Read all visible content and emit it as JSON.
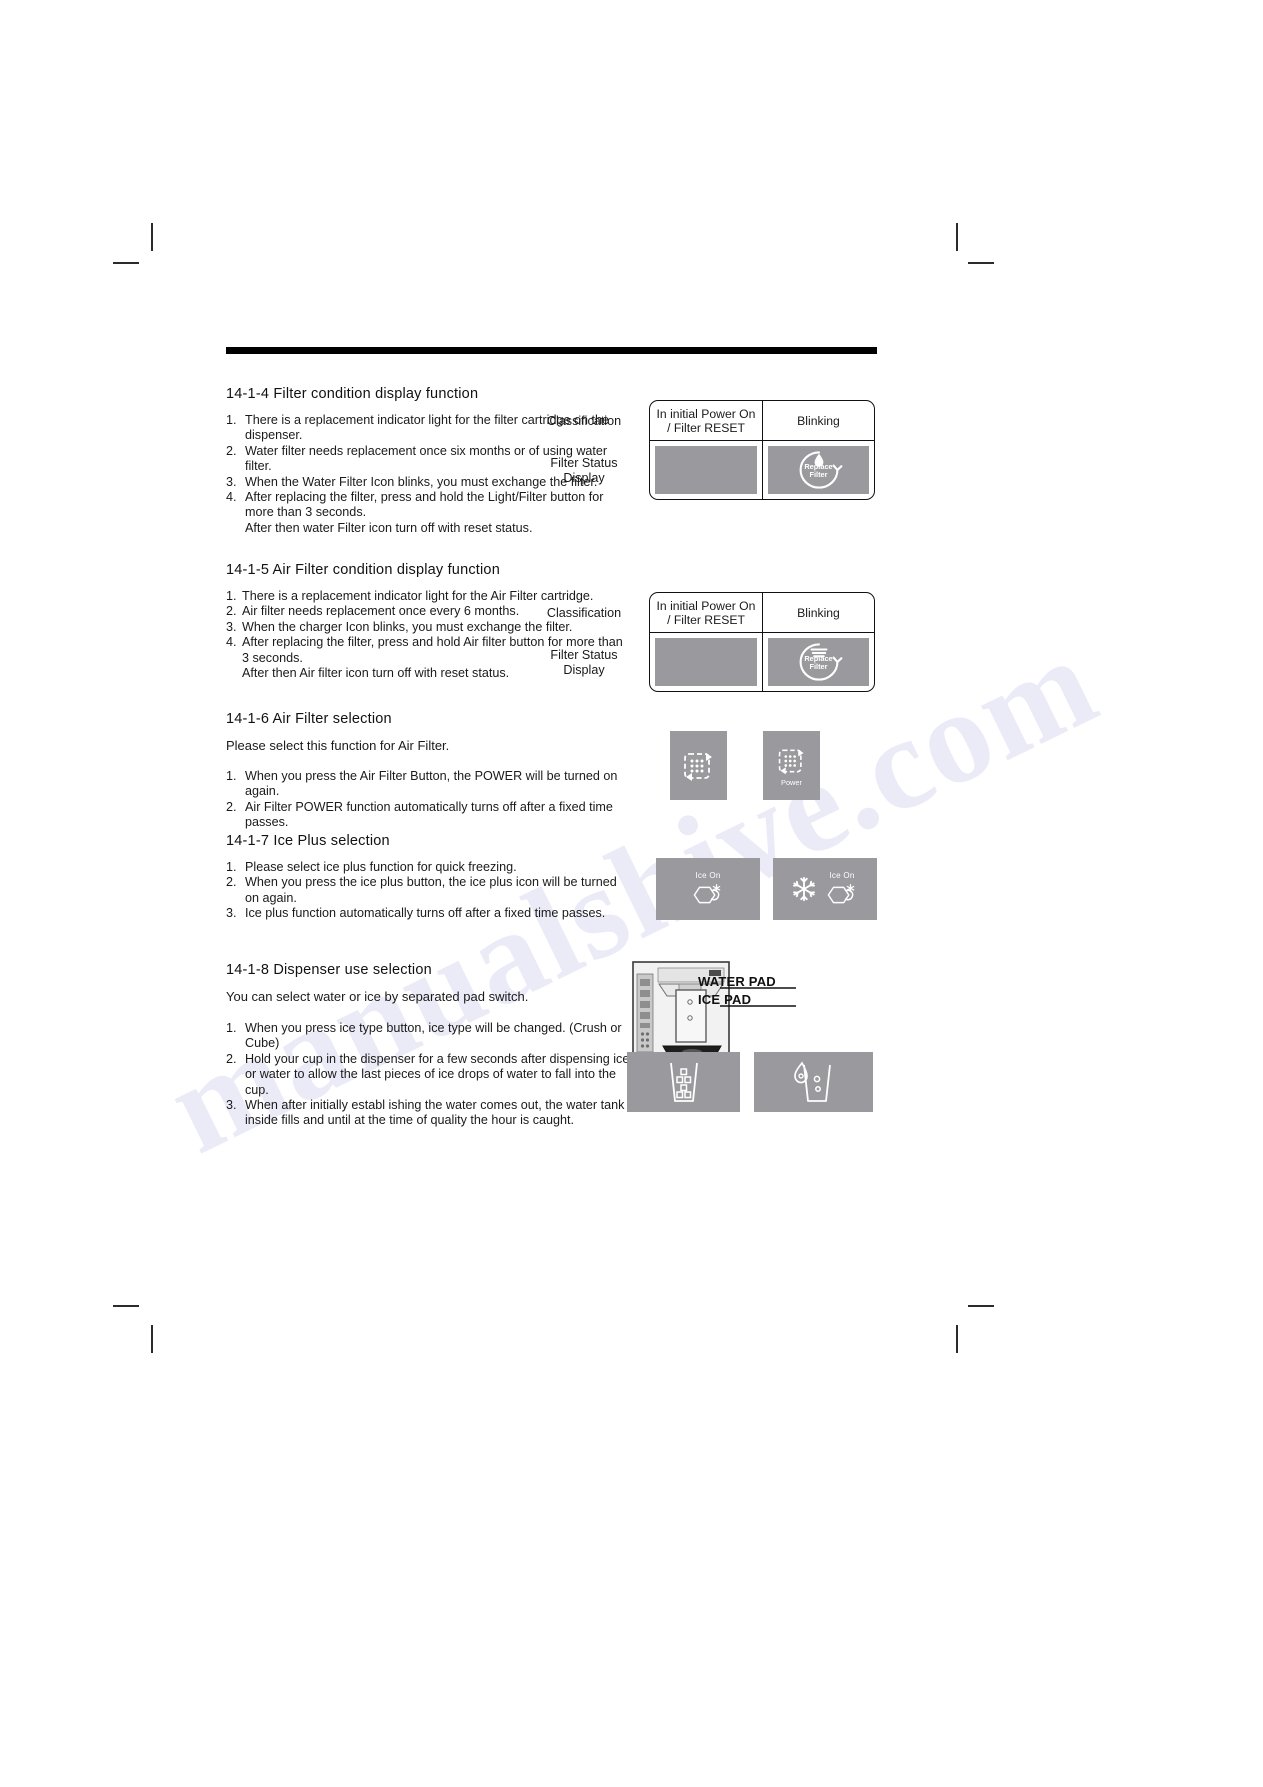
{
  "watermark": "manualshive.com",
  "sections": [
    {
      "id": "14-1-4",
      "title": "14-1-4 Filter condition display function",
      "items": [
        {
          "num": "1.",
          "text": "There is a replacement indicator light for the filter cartridge on the dispenser."
        },
        {
          "num": "2.",
          "text": "Water filter needs replacement once six months or of using water filter."
        },
        {
          "num": "3.",
          "text": "When the Water Filter Icon blinks, you must exchange the filter."
        },
        {
          "num": "4.",
          "text": "After replacing the filter, press and hold the Light/Filter button for more than 3 seconds."
        },
        {
          "num": "",
          "text": "After then water Filter icon turn off with reset status."
        }
      ],
      "table": {
        "row_label_1": "Classification",
        "row_label_2": "Filter Status Display",
        "columns": [
          {
            "header": "In initial Power On / Filter RESET",
            "icon": "blank-gray-swatch"
          },
          {
            "header": "Blinking",
            "icon": "replace-filter-water-icon"
          }
        ],
        "icon_line_1": "Replace",
        "icon_line_2": "Filter"
      }
    },
    {
      "id": "14-1-5",
      "title": "14-1-5 Air Filter condition display function",
      "items": [
        {
          "num": "1.",
          "text": "There is a replacement indicator light for the Air Filter cartridge."
        },
        {
          "num": "2.",
          "text": "Air filter needs replacement once every 6 months."
        },
        {
          "num": "3.",
          "text": "When the charger Icon blinks, you must exchange the filter."
        },
        {
          "num": "4.",
          "text": "After replacing the filter, press and hold Air filter button for more than 3 seconds."
        },
        {
          "num": "",
          "text": "After then Air filter icon turn off with reset status."
        }
      ],
      "table": {
        "row_label_1": "Classification",
        "row_label_2": "Filter Status Display",
        "columns": [
          {
            "header": "In initial Power On / Filter RESET",
            "icon": "blank-gray-swatch"
          },
          {
            "header": "Blinking",
            "icon": "replace-filter-air-icon"
          }
        ],
        "icon_line_1": "Replace",
        "icon_line_2": "Filter"
      }
    },
    {
      "id": "14-1-6",
      "title": "14-1-6 Air Filter selection",
      "lead": "Please select this function for Air Filter.",
      "items": [
        {
          "num": "1.",
          "text": "When you press the Air Filter Button, the  POWER  will be turned on again."
        },
        {
          "num": "2.",
          "text": "Air Filter POWER function automatically turns off after a fixed time passes."
        }
      ],
      "panels": [
        {
          "icon": "air-filter-icon",
          "caption": ""
        },
        {
          "icon": "air-filter-icon",
          "caption": "Power"
        }
      ]
    },
    {
      "id": "14-1-7",
      "title": "14-1-7 Ice Plus selection",
      "items": [
        {
          "num": "1.",
          "text": "Please select ice plus function for quick freezing."
        },
        {
          "num": "2.",
          "text": "When you press the ice plus button, the ice plus icon will be turned on again."
        },
        {
          "num": "3.",
          "text": "Ice plus function automatically turns off after a fixed time passes."
        }
      ],
      "panels": [
        {
          "icon": "ice-cube-snowflake-icon",
          "caption": "Ice On"
        },
        {
          "icon": "snowflake-icon-plus-ice-cube",
          "caption": "Ice On"
        }
      ]
    },
    {
      "id": "14-1-8",
      "title": "14-1-8 Dispenser use selection",
      "lead": "You can select water or ice by separated pad switch.",
      "items": [
        {
          "num": "1.",
          "text": "When you press ice type button, ice type will be changed. (Crush or Cube)"
        },
        {
          "num": "2.",
          "text": "Hold your cup in the dispenser for a few seconds after dispensing ice or water to allow the last pieces of ice drops of water to fall into the cup."
        },
        {
          "num": "3.",
          "text": "When after initially establ ishing the water comes out, the water tank inside fills and until at the time of quality the hour is caught."
        }
      ],
      "callouts": [
        {
          "label": "WATER PAD"
        },
        {
          "label": "ICE PAD"
        }
      ],
      "panels": [
        {
          "icon": "cup-with-ice-cubes-icon",
          "caption": ""
        },
        {
          "icon": "cup-with-water-drops-icon",
          "caption": ""
        }
      ]
    }
  ]
}
